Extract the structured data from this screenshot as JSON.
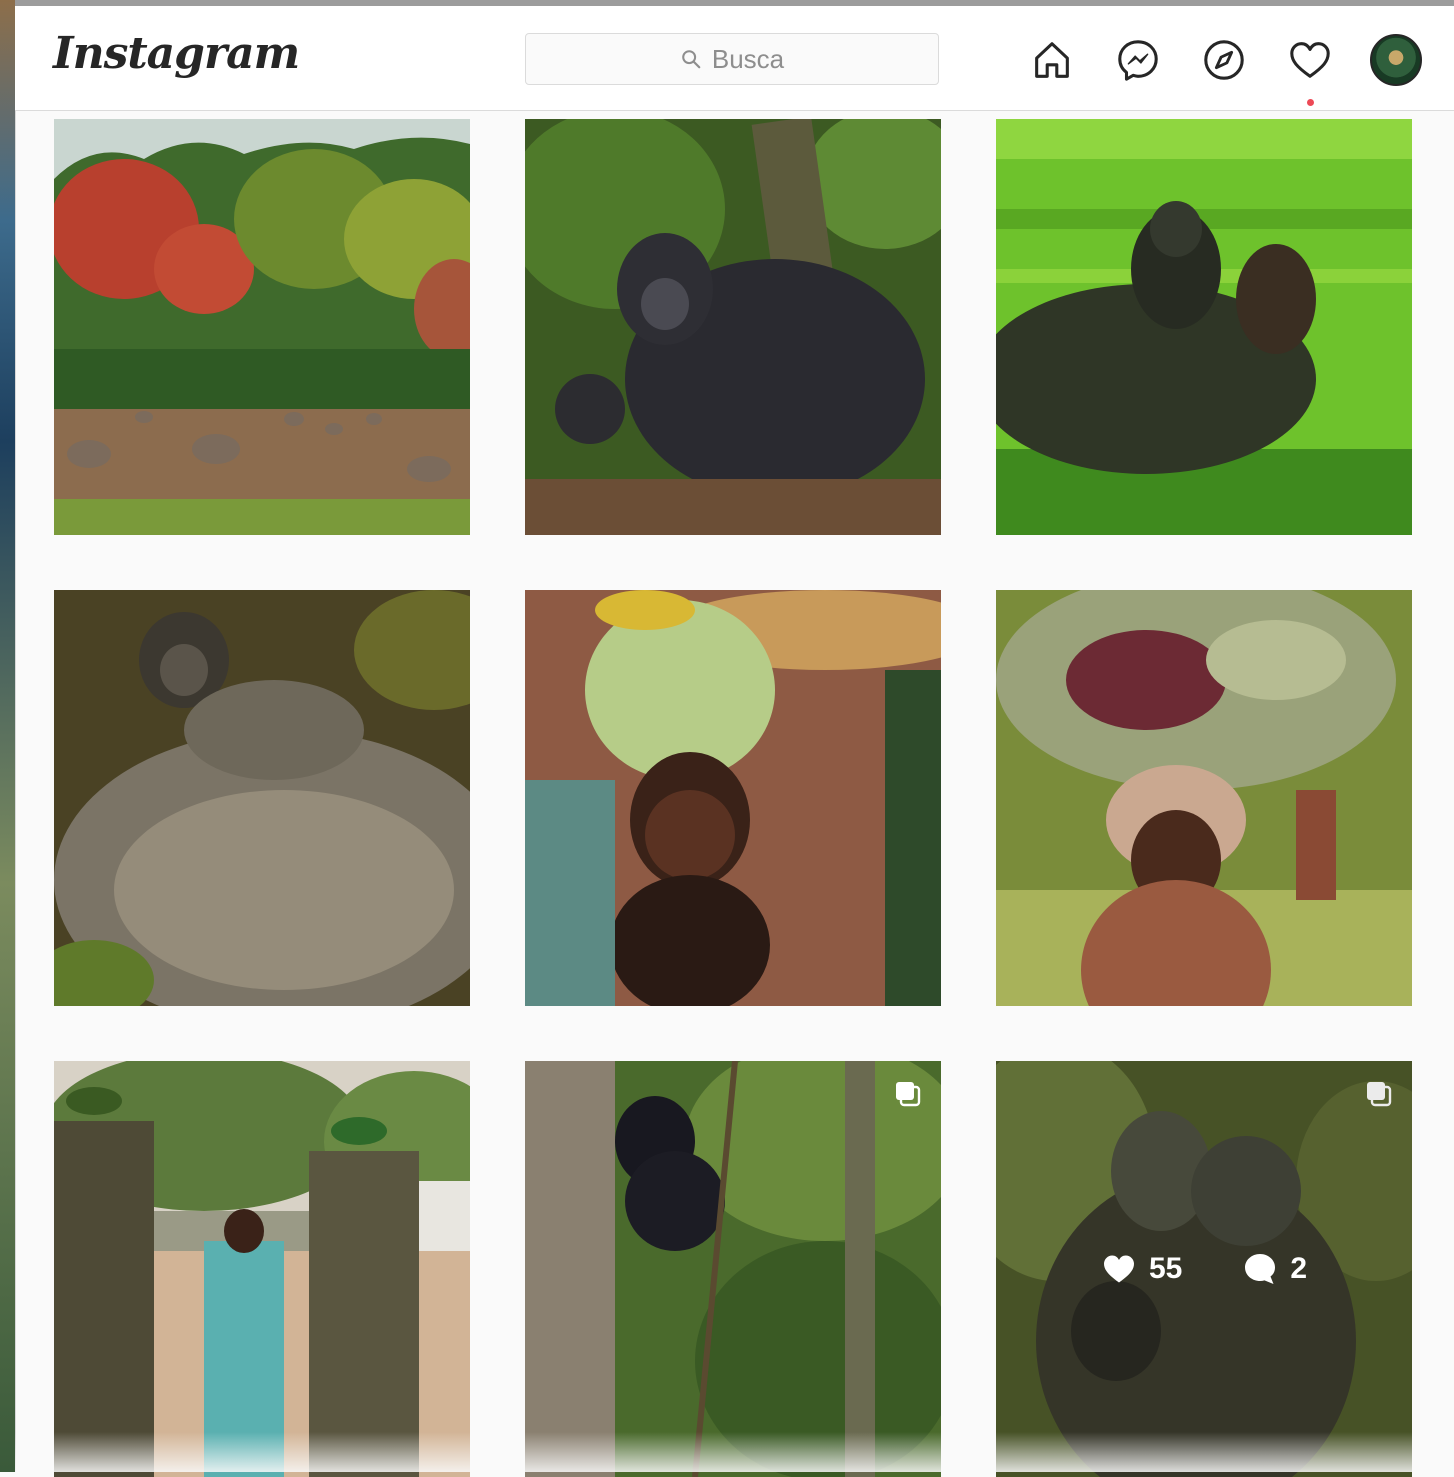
{
  "header": {
    "logo_text": "Instagram",
    "search": {
      "placeholder": "Busca"
    },
    "nav": [
      "home-icon",
      "messenger-icon",
      "explore-icon",
      "activity-heart-icon",
      "profile-avatar"
    ]
  },
  "colors": {
    "notification_dot": "#ed4956",
    "border": "#dbdbdb",
    "background": "#fafafa"
  },
  "grid": {
    "posts": [
      {
        "id": "elephants",
        "multi": false
      },
      {
        "id": "gorilla-silverback",
        "multi": false
      },
      {
        "id": "gorilla-motion",
        "multi": false
      },
      {
        "id": "gorilla-baby",
        "multi": false
      },
      {
        "id": "child-leaf-hat",
        "multi": false
      },
      {
        "id": "child-leaves",
        "multi": false
      },
      {
        "id": "rangers",
        "multi": false
      },
      {
        "id": "gorilla-climbing",
        "multi": true
      },
      {
        "id": "gorilla-hug",
        "multi": true,
        "hover": true,
        "likes": "55",
        "comments": "2"
      }
    ]
  }
}
